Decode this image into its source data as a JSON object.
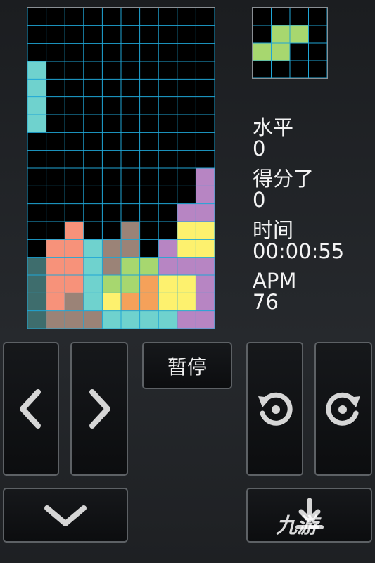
{
  "board": {
    "cols": 10,
    "rows": 18,
    "grid_color": "#1fa6d6",
    "palette": {
      "I": "#6fd2ce",
      "T": "#b785c3",
      "O": "#fdf16e",
      "S": "#a7d76f",
      "Z": "#f7927a",
      "L": "#f5a15a",
      "J": "#9b8377",
      "D": "#3e6d6d"
    },
    "cells": [
      "..........",
      "..........",
      "..........",
      "I.........",
      "I.........",
      "I.........",
      "I.........",
      "..........",
      "..........",
      ".........T",
      ".........T",
      "........TT",
      "..Z..J..OO",
      ".ZZIJJ.TOO",
      "DZZIJSSTTT",
      "DZZISSLOOT",
      "DZJIOLLOOT",
      "DJJJIIIITT"
    ]
  },
  "next_piece": {
    "color": "#a7d76f",
    "cells": [
      "....",
      ".SS.",
      "SS..",
      "...."
    ]
  },
  "stats": {
    "level_label": "水平",
    "level_value": "0",
    "score_label": "得分了",
    "score_value": "0",
    "time_label": "时间",
    "time_value": "00:00:55",
    "apm_label": "APM",
    "apm_value": "76"
  },
  "controls": {
    "pause_label": "暂停",
    "icons": [
      "chevron-left-icon",
      "chevron-right-icon",
      "chevron-down-icon",
      "rotate-ccw-icon",
      "rotate-cw-icon",
      "hard-drop-icon"
    ]
  },
  "watermark": {
    "text": "九游"
  }
}
